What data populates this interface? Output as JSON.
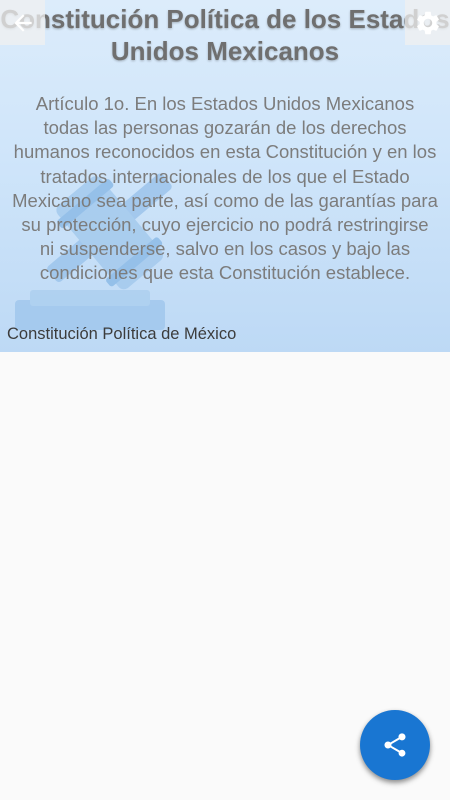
{
  "header": {
    "title": "Constitución Política de los Estados Unidos Mexicanos",
    "back_icon": "arrow-left-icon",
    "settings_icon": "gear-icon"
  },
  "article": {
    "text": "Artículo 1o. En los Estados Unidos Mexicanos todas las personas gozarán de los derechos humanos reconocidos en esta Constitución y en los tratados internacionales de los que el Estado Mexicano sea parte, así como de las garantías para su protección, cuyo ejercicio no podrá restringirse ni suspenderse, salvo en los casos y bajo las condiciones que esta Constitución establece."
  },
  "caption": "Constitución Política de México",
  "fab": {
    "icon": "share-icon",
    "color": "#1976d2"
  },
  "colors": {
    "hero_top": "#dcecfb",
    "hero_bottom": "#bdd9f5",
    "gavel": "#a9cdef",
    "title": "#6f6f6f",
    "body_text": "#7c7c7c",
    "background": "#fafafa"
  }
}
